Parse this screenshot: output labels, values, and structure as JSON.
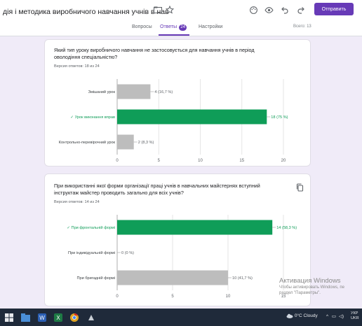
{
  "header": {
    "doc_title": "дія і методика виробничого навчання учнів в нав",
    "send_label": "Отправить",
    "tabs": [
      {
        "label": "Вопросы"
      },
      {
        "label": "Ответы",
        "badge": "24"
      },
      {
        "label": "Настройки"
      }
    ],
    "total": "Всего: 13"
  },
  "questions": [
    {
      "title": "Який тип уроку виробничого навчання не застосовується для навчання учнів в період оволодіння спеціальністю?",
      "count": "Версия ответов: 18 из 24"
    },
    {
      "title": "При використанні якої форми організації праці учнів в навчальних майстернях вступний інструктаж майстер проводить загально для всіх учнів?",
      "count": "Версия ответов: 14 из 24"
    }
  ],
  "chart_data": [
    {
      "type": "bar",
      "orientation": "horizontal",
      "categories": [
        "Змішаний урок",
        "✓ Урок виконання вправ",
        "Контрольно-перевірочний урок"
      ],
      "values": [
        4,
        18,
        2
      ],
      "data_labels": [
        "4 (16,7 %)",
        "18 (75 %)",
        "2 (8,3 %)"
      ],
      "correct_index": 1,
      "xlim": [
        0,
        20
      ],
      "ticks": [
        0,
        5,
        10,
        15,
        20
      ],
      "grid": true
    },
    {
      "type": "bar",
      "orientation": "horizontal",
      "categories": [
        "✓ При фронтальній формі",
        "При індивідуальній формі",
        "При бригадній формі"
      ],
      "values": [
        14,
        0,
        10
      ],
      "data_labels": [
        "14 (58,3 %)",
        "0 (0 %)",
        "10 (41,7 %)"
      ],
      "correct_index": 0,
      "xlim": [
        0,
        15
      ],
      "ticks": [
        0,
        5,
        10,
        15
      ],
      "grid": true
    }
  ],
  "colors": {
    "accent": "#673ab7",
    "bar_correct": "#0f9d58",
    "bar_default": "#bdbdbd",
    "background": "#f0ebf8"
  },
  "taskbar": {
    "weather": "0°C Cloudy",
    "lang": "УКР",
    "lang2": "UKR"
  },
  "activation": {
    "title": "Активация Windows",
    "line1": "Чтобы активировать Windows, пе",
    "line2": "раздел \"Параметры\"."
  }
}
